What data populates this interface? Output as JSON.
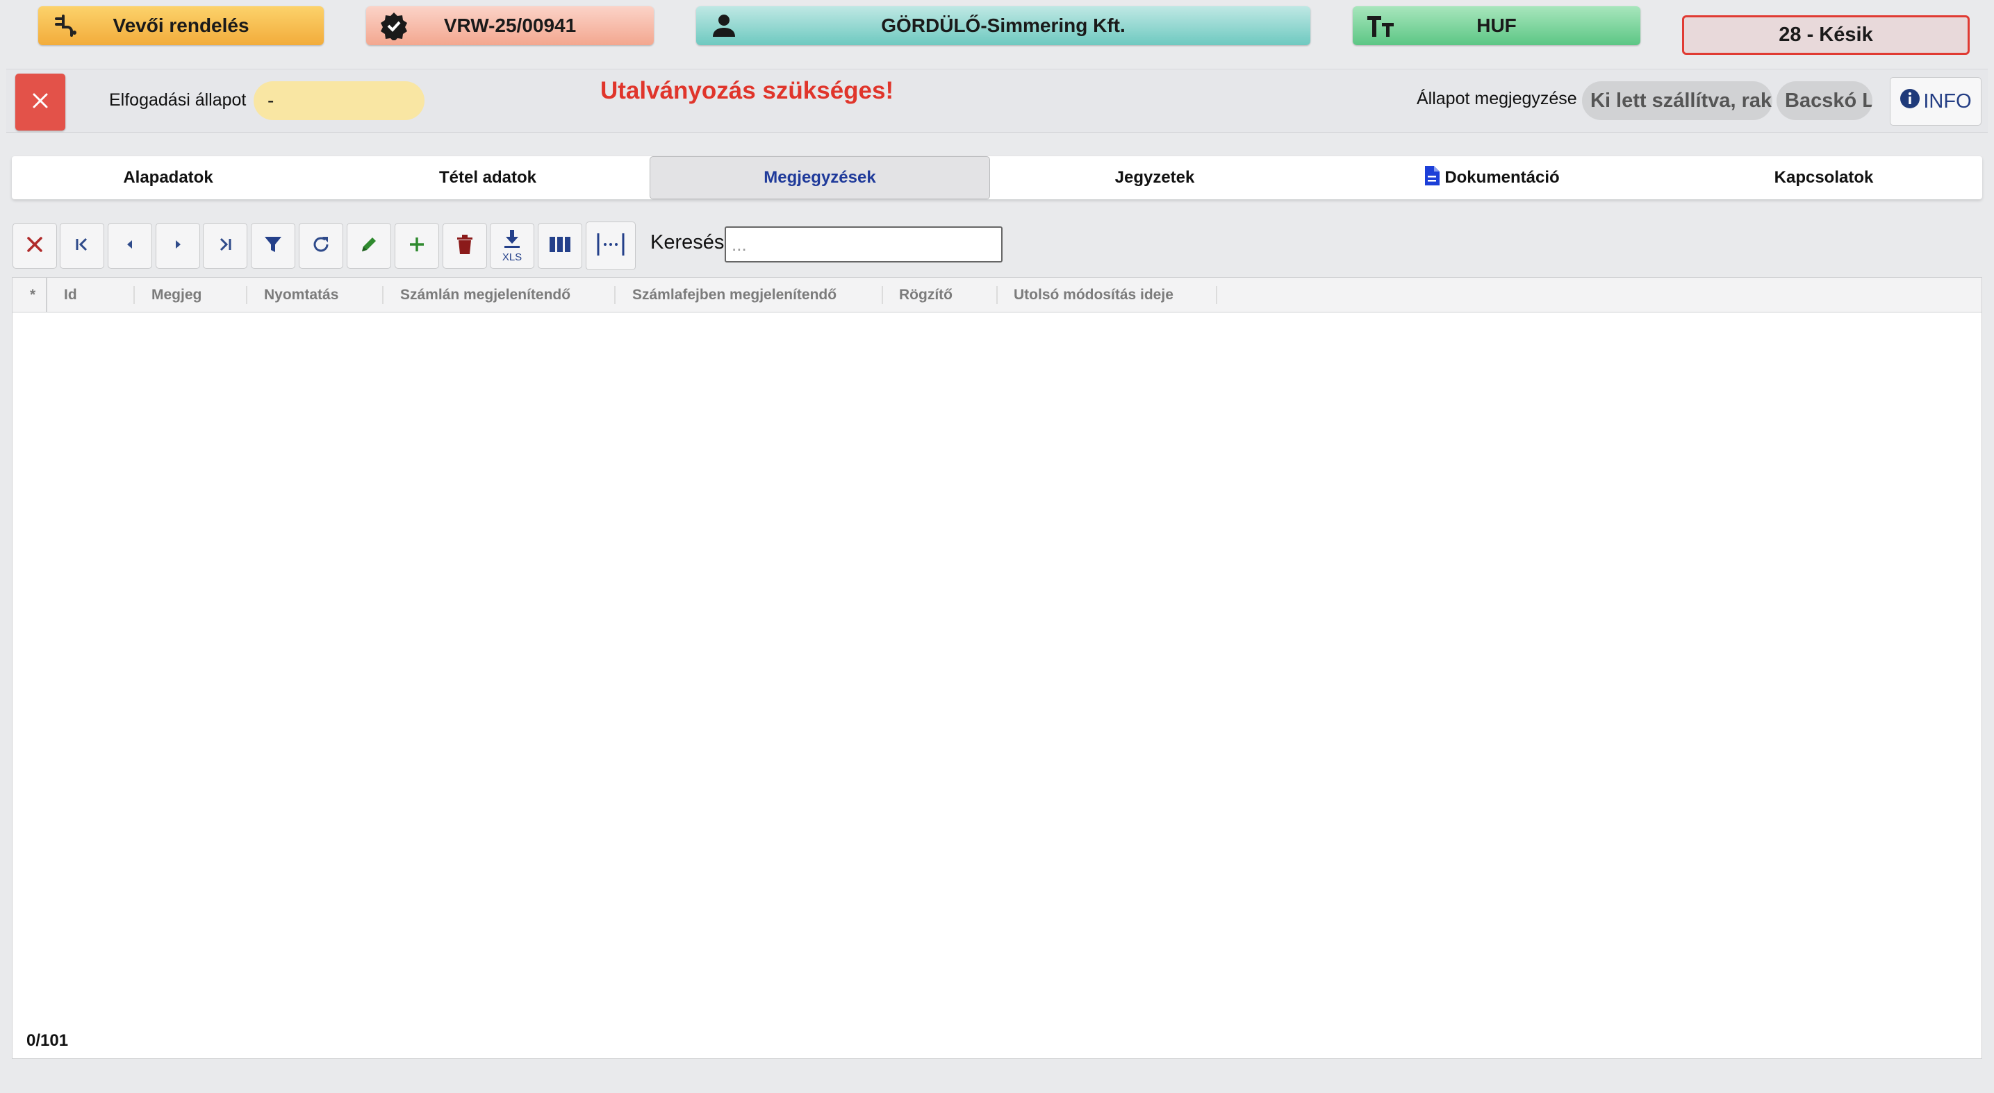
{
  "header": {
    "order_type": "Vevői rendelés",
    "document_number": "VRW-25/00941",
    "partner": "GÖRDÜLŐ-Simmering Kft.",
    "currency": "HUF",
    "status": "28 - Késik"
  },
  "status_row": {
    "acceptance_label": "Elfogadási állapot",
    "acceptance_value": "-",
    "warning": "Utalványozás szükséges!",
    "note_label": "Állapot megjegyzése",
    "note_value_1": "Ki lett szállítva, rak",
    "note_value_2": "Bacskó L",
    "info_label": "INFO"
  },
  "tabs": [
    {
      "label": "Alapadatok"
    },
    {
      "label": "Tétel adatok"
    },
    {
      "label": "Megjegyzések"
    },
    {
      "label": "Jegyzetek"
    },
    {
      "label": "Dokumentáció"
    },
    {
      "label": "Kapcsolatok"
    }
  ],
  "active_tab": "Megjegyzések",
  "toolbar": {
    "export_caption": "XLS",
    "search_label": "Keresés:",
    "search_placeholder": "...",
    "search_value": ""
  },
  "table": {
    "columns": [
      "*",
      "Id",
      "Megjeg",
      "Nyomtatás",
      "Számlán megjelenítendő",
      "Számlafejben megjelenítendő",
      "Rögzítő",
      "Utolsó módosítás ideje"
    ],
    "rows": [],
    "counter": "0/101"
  },
  "colors": {
    "accent_red": "#e0352b",
    "active_tab_text": "#1f3a9a",
    "info_blue": "#233d84"
  },
  "icons": {
    "order_type": "plug-icon",
    "document": "verified-badge-icon",
    "partner": "person-icon",
    "currency": "text-size-icon",
    "documentation_tab": "document-icon"
  }
}
